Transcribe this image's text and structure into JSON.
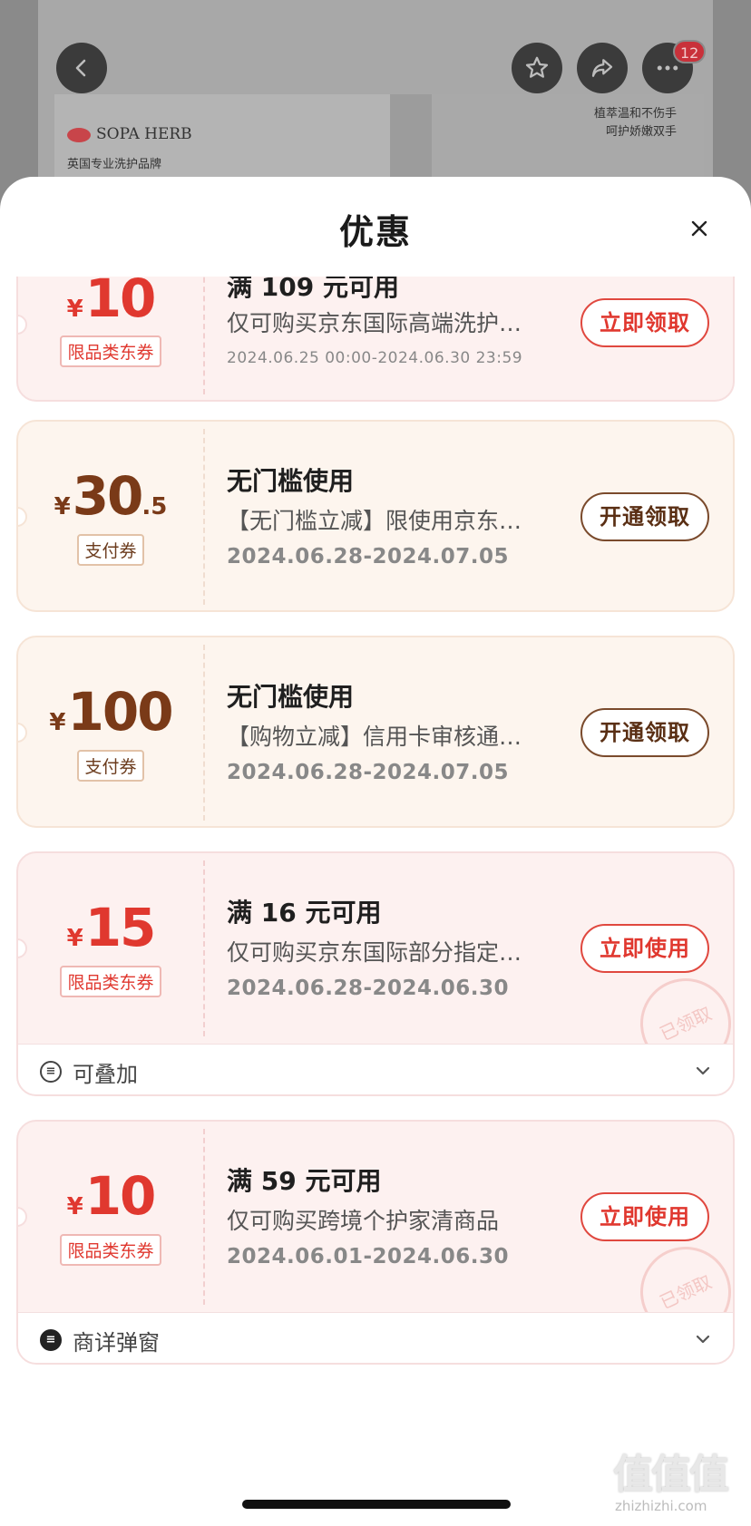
{
  "header": {
    "badge_count": "12",
    "banner_brand": "SOPA HERB",
    "banner_sub": "英国专业洗护品牌",
    "banner_right_line1": "植萃温和不伤手",
    "banner_right_line2": "呵护娇嫩双手"
  },
  "sheet": {
    "title": "优惠"
  },
  "coupons": [
    {
      "yen": "¥",
      "amount": "10",
      "decimal": "",
      "tag": "限品类东券",
      "title": "满 109 元可用",
      "desc": "仅可购买京东国际高端洗护…",
      "date": "2024.06.25 00:00-2024.06.30 23:59",
      "action": "立即领取"
    },
    {
      "yen": "¥",
      "amount": "30",
      "decimal": ".5",
      "tag": "支付券",
      "title": "无门槛使用",
      "desc": "【无门槛立减】限使用京东…",
      "date": "2024.06.28-2024.07.05",
      "action": "开通领取"
    },
    {
      "yen": "¥",
      "amount": "100",
      "decimal": "",
      "tag": "支付券",
      "title": "无门槛使用",
      "desc": "【购物立减】信用卡审核通…",
      "date": "2024.06.28-2024.07.05",
      "action": "开通领取"
    },
    {
      "yen": "¥",
      "amount": "15",
      "decimal": "",
      "tag": "限品类东券",
      "title": "满 16 元可用",
      "desc": "仅可购买京东国际部分指定…",
      "date": "2024.06.28-2024.06.30",
      "action": "立即使用",
      "stamp": "已领取",
      "footer": "可叠加"
    },
    {
      "yen": "¥",
      "amount": "10",
      "decimal": "",
      "tag": "限品类东券",
      "title": "满 59 元可用",
      "desc": "仅可购买跨境个护家清商品",
      "date": "2024.06.01-2024.06.30",
      "action": "立即使用",
      "stamp": "已领取",
      "footer": "商详弹窗"
    }
  ],
  "watermark": {
    "logo": "值值值",
    "site": "zhizhizhi.com"
  }
}
